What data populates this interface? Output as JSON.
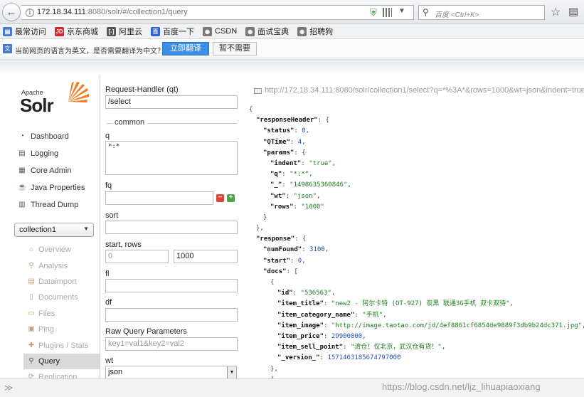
{
  "browser": {
    "url_host": "172.18.34.111",
    "url_path": ":8080/solr/#/collection1/query",
    "search_placeholder": "百度 <Ctrl+K>",
    "icons": {
      "back": "back-arrow-icon",
      "reload": "reload-icon",
      "star": "bookmark-star-icon",
      "menu": "reading-list-icon"
    }
  },
  "bookmarks": [
    {
      "label": "最常访问",
      "icon_color": "#4a79c7",
      "icon_glyph": "▤"
    },
    {
      "label": "京东商城",
      "icon_color": "#d9252a",
      "icon_glyph": "JD"
    },
    {
      "label": "阿里云",
      "icon_color": "#555555",
      "icon_glyph": "[-]"
    },
    {
      "label": "百度一下",
      "icon_color": "#2d64d4",
      "icon_glyph": "百"
    },
    {
      "label": "CSDN",
      "icon_color": "#777777",
      "icon_glyph": "◉"
    },
    {
      "label": "面试宝典",
      "icon_color": "#777777",
      "icon_glyph": "◉"
    },
    {
      "label": "招聘狗",
      "icon_color": "#777777",
      "icon_glyph": "◉"
    }
  ],
  "translate_bar": {
    "message": "当前网页的语言为英文，是否需要翻译为中文？",
    "translate_button": "立即翻译",
    "dismiss_button": "暂不需要"
  },
  "logo": {
    "apache": "Apache",
    "solr": "Solr"
  },
  "sidebar": {
    "items": [
      {
        "label": "Dashboard",
        "icon": "dashboard-icon",
        "glyph": "◔"
      },
      {
        "label": "Logging",
        "icon": "logging-icon",
        "glyph": "▤"
      },
      {
        "label": "Core Admin",
        "icon": "core-admin-icon",
        "glyph": "▦"
      },
      {
        "label": "Java Properties",
        "icon": "java-properties-icon",
        "glyph": "☕"
      },
      {
        "label": "Thread Dump",
        "icon": "thread-dump-icon",
        "glyph": "▥"
      }
    ],
    "core_selector": "collection1",
    "core_menu": [
      {
        "label": "Overview",
        "icon": "overview-icon",
        "glyph": "⌂",
        "active": false
      },
      {
        "label": "Analysis",
        "icon": "analysis-icon",
        "glyph": "⚲",
        "active": false
      },
      {
        "label": "Dataimport",
        "icon": "dataimport-icon",
        "glyph": "▤",
        "active": false
      },
      {
        "label": "Documents",
        "icon": "documents-icon",
        "glyph": "▯",
        "active": false
      },
      {
        "label": "Files",
        "icon": "files-icon",
        "glyph": "▭",
        "active": false
      },
      {
        "label": "Ping",
        "icon": "ping-icon",
        "glyph": "▣",
        "active": false
      },
      {
        "label": "Plugins / Stats",
        "icon": "plugins-icon",
        "glyph": "✚",
        "active": false
      },
      {
        "label": "Query",
        "icon": "query-icon",
        "glyph": "⚲",
        "active": true
      },
      {
        "label": "Replication",
        "icon": "replication-icon",
        "glyph": "⟳",
        "active": false
      }
    ]
  },
  "query_form": {
    "request_handler_label": "Request-Handler (qt)",
    "request_handler_value": "/select",
    "common_legend": "common",
    "q_label": "q",
    "q_value": "*:*",
    "fq_label": "fq",
    "fq_value": "",
    "sort_label": "sort",
    "sort_value": "",
    "start_rows_label": "start, rows",
    "start_placeholder": "0",
    "rows_value": "1000",
    "fl_label": "fl",
    "fl_value": "",
    "df_label": "df",
    "df_value": "",
    "raw_params_label": "Raw Query Parameters",
    "raw_params_placeholder": "key1=val1&key2=val2",
    "wt_label": "wt",
    "wt_value": "json"
  },
  "response": {
    "url": "http://172.18.34.111:8080/solr/collection1/select?q=*%3A*&rows=1000&wt=json&indent=true",
    "lines": [
      {
        "indent": 0,
        "parts": [
          {
            "t": "p",
            "v": "{"
          }
        ]
      },
      {
        "indent": 1,
        "parts": [
          {
            "t": "k",
            "v": "\"responseHeader\""
          },
          {
            "t": "p",
            "v": ": {"
          }
        ]
      },
      {
        "indent": 2,
        "parts": [
          {
            "t": "k",
            "v": "\"status\""
          },
          {
            "t": "p",
            "v": ": "
          },
          {
            "t": "n",
            "v": "0"
          },
          {
            "t": "p",
            "v": ","
          }
        ]
      },
      {
        "indent": 2,
        "parts": [
          {
            "t": "k",
            "v": "\"QTime\""
          },
          {
            "t": "p",
            "v": ": "
          },
          {
            "t": "n",
            "v": "4"
          },
          {
            "t": "p",
            "v": ","
          }
        ]
      },
      {
        "indent": 2,
        "parts": [
          {
            "t": "k",
            "v": "\"params\""
          },
          {
            "t": "p",
            "v": ": {"
          }
        ]
      },
      {
        "indent": 3,
        "parts": [
          {
            "t": "k",
            "v": "\"indent\""
          },
          {
            "t": "p",
            "v": ": "
          },
          {
            "t": "s",
            "v": "\"true\""
          },
          {
            "t": "p",
            "v": ","
          }
        ]
      },
      {
        "indent": 3,
        "parts": [
          {
            "t": "k",
            "v": "\"q\""
          },
          {
            "t": "p",
            "v": ": "
          },
          {
            "t": "s",
            "v": "\"*:*\""
          },
          {
            "t": "p",
            "v": ","
          }
        ]
      },
      {
        "indent": 3,
        "parts": [
          {
            "t": "k",
            "v": "\"_\""
          },
          {
            "t": "p",
            "v": ": "
          },
          {
            "t": "s",
            "v": "\"1498635360846\""
          },
          {
            "t": "p",
            "v": ","
          }
        ]
      },
      {
        "indent": 3,
        "parts": [
          {
            "t": "k",
            "v": "\"wt\""
          },
          {
            "t": "p",
            "v": ": "
          },
          {
            "t": "s",
            "v": "\"json\""
          },
          {
            "t": "p",
            "v": ","
          }
        ]
      },
      {
        "indent": 3,
        "parts": [
          {
            "t": "k",
            "v": "\"rows\""
          },
          {
            "t": "p",
            "v": ": "
          },
          {
            "t": "s",
            "v": "\"1000\""
          }
        ]
      },
      {
        "indent": 2,
        "parts": [
          {
            "t": "p",
            "v": "}"
          }
        ]
      },
      {
        "indent": 1,
        "parts": [
          {
            "t": "p",
            "v": "},"
          }
        ]
      },
      {
        "indent": 1,
        "parts": [
          {
            "t": "k",
            "v": "\"response\""
          },
          {
            "t": "p",
            "v": ": {"
          }
        ]
      },
      {
        "indent": 2,
        "parts": [
          {
            "t": "k",
            "v": "\"numFound\""
          },
          {
            "t": "p",
            "v": ": "
          },
          {
            "t": "n",
            "v": "3100"
          },
          {
            "t": "p",
            "v": ","
          }
        ]
      },
      {
        "indent": 2,
        "parts": [
          {
            "t": "k",
            "v": "\"start\""
          },
          {
            "t": "p",
            "v": ": "
          },
          {
            "t": "n",
            "v": "0"
          },
          {
            "t": "p",
            "v": ","
          }
        ]
      },
      {
        "indent": 2,
        "parts": [
          {
            "t": "k",
            "v": "\"docs\""
          },
          {
            "t": "p",
            "v": ": ["
          }
        ]
      },
      {
        "indent": 3,
        "parts": [
          {
            "t": "p",
            "v": "{"
          }
        ]
      },
      {
        "indent": 4,
        "parts": [
          {
            "t": "k",
            "v": "\"id\""
          },
          {
            "t": "p",
            "v": ": "
          },
          {
            "t": "s",
            "v": "\"536563\""
          },
          {
            "t": "p",
            "v": ","
          }
        ]
      },
      {
        "indent": 4,
        "parts": [
          {
            "t": "k",
            "v": "\"item_title\""
          },
          {
            "t": "p",
            "v": ": "
          },
          {
            "t": "s",
            "v": "\"new2 - 阿尔卡特 (OT-927) 炭黑 联通3G手机 双卡双待\""
          },
          {
            "t": "p",
            "v": ","
          }
        ]
      },
      {
        "indent": 4,
        "parts": [
          {
            "t": "k",
            "v": "\"item_category_name\""
          },
          {
            "t": "p",
            "v": ": "
          },
          {
            "t": "s",
            "v": "\"手机\""
          },
          {
            "t": "p",
            "v": ","
          }
        ]
      },
      {
        "indent": 4,
        "parts": [
          {
            "t": "k",
            "v": "\"item_image\""
          },
          {
            "t": "p",
            "v": ": "
          },
          {
            "t": "s",
            "v": "\"http://image.taotao.com/jd/4ef8861cf6854de9889f3db9b24dc371.jpg\""
          },
          {
            "t": "p",
            "v": ","
          }
        ]
      },
      {
        "indent": 4,
        "parts": [
          {
            "t": "k",
            "v": "\"item_price\""
          },
          {
            "t": "p",
            "v": ": "
          },
          {
            "t": "n",
            "v": "29900000"
          },
          {
            "t": "p",
            "v": ","
          }
        ]
      },
      {
        "indent": 4,
        "parts": [
          {
            "t": "k",
            "v": "\"item_sell_point\""
          },
          {
            "t": "p",
            "v": ": "
          },
          {
            "t": "s",
            "v": "\"清仓！仅北京，武汉仓有货！\""
          },
          {
            "t": "p",
            "v": ","
          }
        ]
      },
      {
        "indent": 4,
        "parts": [
          {
            "t": "k",
            "v": "\"_version_\""
          },
          {
            "t": "p",
            "v": ": "
          },
          {
            "t": "n",
            "v": "1571463185674797000"
          }
        ]
      },
      {
        "indent": 3,
        "parts": [
          {
            "t": "p",
            "v": "},"
          }
        ]
      },
      {
        "indent": 3,
        "parts": [
          {
            "t": "p",
            "v": "{"
          }
        ]
      }
    ]
  },
  "statusbar": {
    "watermark": "https://blog.csdn.net/ljz_lihuapiaoxiang"
  }
}
